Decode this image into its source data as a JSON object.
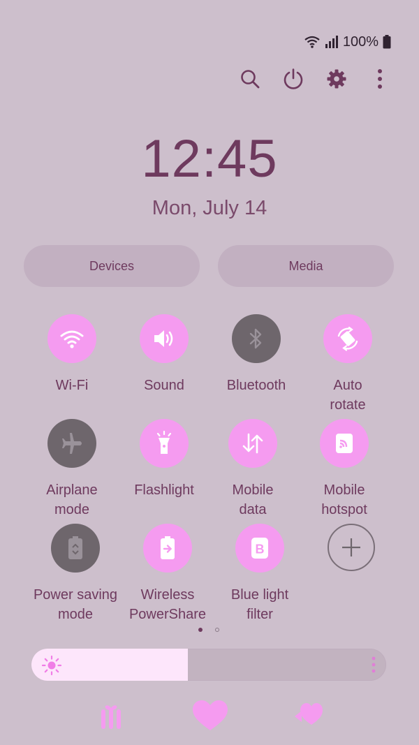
{
  "status_bar": {
    "battery_text": "100%",
    "icons": [
      "wifi-icon",
      "signal-icon",
      "battery-icon"
    ]
  },
  "top_actions": [
    "search-icon",
    "power-icon",
    "gear-icon",
    "more-vert-icon"
  ],
  "clock": {
    "time": "12:45",
    "date": "Mon, July 14"
  },
  "buttons": {
    "devices": "Devices",
    "media": "Media"
  },
  "tiles": [
    {
      "label": "Wi-Fi",
      "state": "on",
      "icon": "wifi-icon"
    },
    {
      "label": "Sound",
      "state": "on",
      "icon": "sound-icon"
    },
    {
      "label": "Bluetooth",
      "state": "off",
      "icon": "bluetooth-icon"
    },
    {
      "label": "Auto\nrotate",
      "state": "on",
      "icon": "rotate-icon"
    },
    {
      "label": "Airplane\nmode",
      "state": "off",
      "icon": "airplane-icon"
    },
    {
      "label": "Flashlight",
      "state": "on",
      "icon": "flashlight-icon"
    },
    {
      "label": "Mobile\ndata",
      "state": "on",
      "icon": "mobile-data-icon"
    },
    {
      "label": "Mobile\nhotspot",
      "state": "on",
      "icon": "hotspot-icon"
    },
    {
      "label": "Power saving\nmode",
      "state": "off",
      "icon": "power-saving-icon"
    },
    {
      "label": "Wireless\nPowerShare",
      "state": "on",
      "icon": "powershare-icon"
    },
    {
      "label": "Blue light\nfilter",
      "state": "on",
      "icon": "blue-light-icon"
    },
    {
      "label": "",
      "state": "add",
      "icon": "add-icon"
    }
  ],
  "page_indicator": {
    "current": 1,
    "total": 2
  },
  "brightness": {
    "level": 0.44
  },
  "bottom_nav": [
    "recents-icon",
    "home-heart-icon",
    "back-icon"
  ],
  "colors": {
    "background": "#cdbfcc",
    "tile_on": "#f59bf0",
    "tile_off": "#6e666c",
    "text": "#6e3a5e",
    "brightness_fill": "#fde6fb"
  }
}
